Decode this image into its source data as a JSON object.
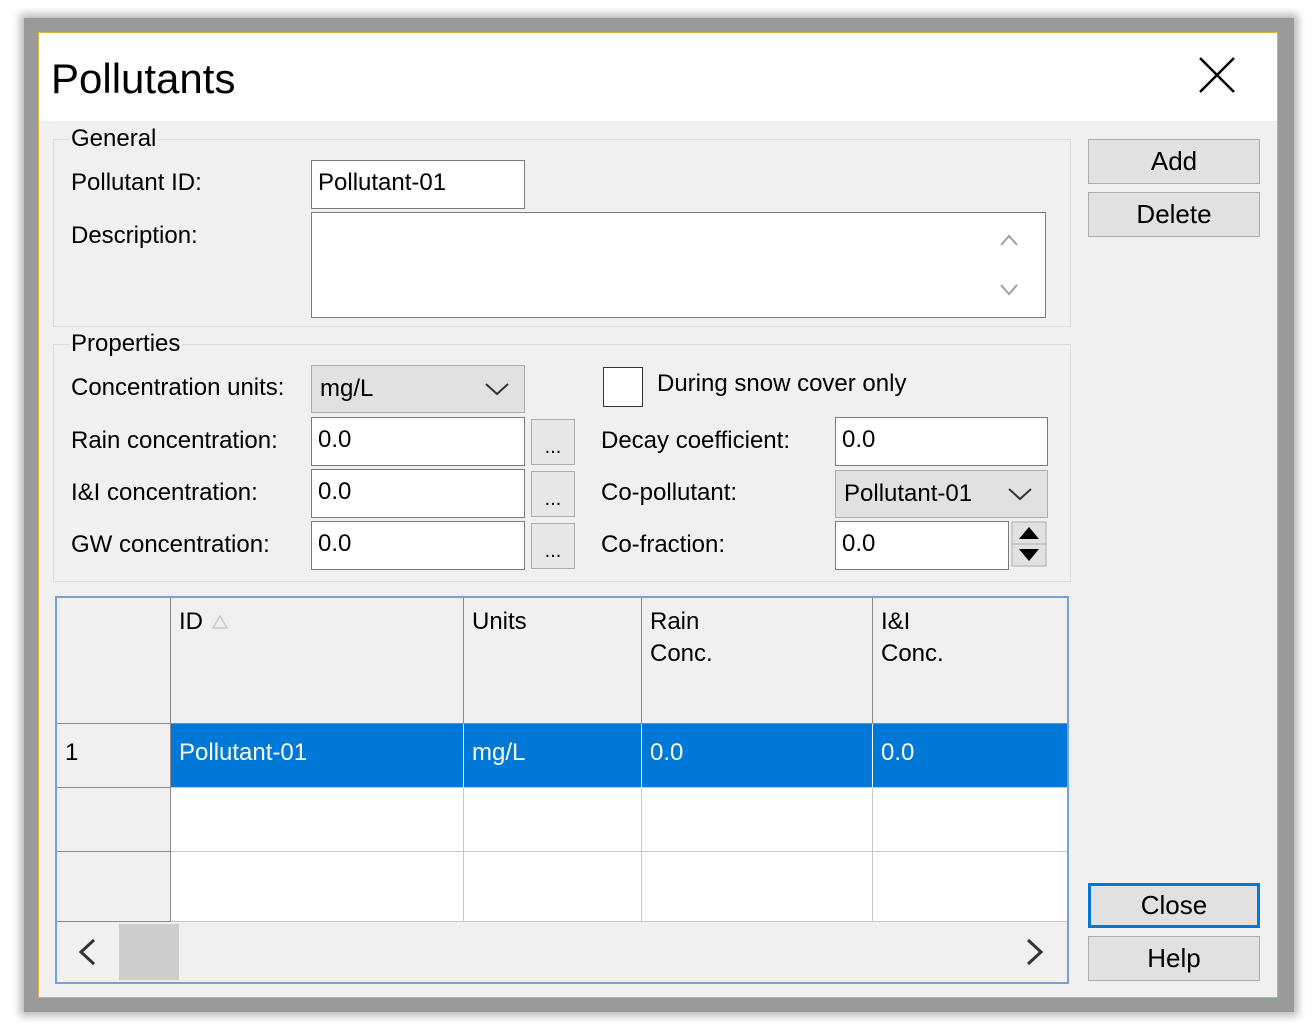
{
  "window": {
    "title": "Pollutants"
  },
  "general": {
    "title": "General",
    "pollutant_id_label": "Pollutant ID:",
    "pollutant_id_value": "Pollutant-01",
    "description_label": "Description:",
    "description_value": ""
  },
  "properties": {
    "title": "Properties",
    "conc_units_label": "Concentration units:",
    "conc_units_value": "mg/L",
    "rain_conc_label": "Rain concentration:",
    "rain_conc_value": "0.0",
    "ii_conc_label": "I&I concentration:",
    "ii_conc_value": "0.0",
    "gw_conc_label": "GW concentration:",
    "gw_conc_value": "0.0",
    "ellipsis": "...",
    "snow_only_label": "During snow cover only",
    "snow_only_checked": false,
    "decay_label": "Decay coefficient:",
    "decay_value": "0.0",
    "co_pollutant_label": "Co-pollutant:",
    "co_pollutant_value": "Pollutant-01",
    "co_fraction_label": "Co-fraction:",
    "co_fraction_value": "0.0"
  },
  "buttons": {
    "add": "Add",
    "delete": "Delete",
    "close": "Close",
    "help": "Help"
  },
  "table": {
    "headers": [
      {
        "line1": "ID",
        "line2": ""
      },
      {
        "line1": "Units",
        "line2": ""
      },
      {
        "line1": "Rain",
        "line2": "Conc."
      },
      {
        "line1": "I&I",
        "line2": "Conc."
      }
    ],
    "rows": [
      {
        "index": "1",
        "id": "Pollutant-01",
        "units": "mg/L",
        "rain": "0.0",
        "ii": "0.0"
      }
    ]
  },
  "colors": {
    "selection": "#0078d7",
    "accent_border": "#d6b340"
  },
  "icons": {
    "close": "close-x-icon",
    "dropdown": "chevron-down-icon",
    "spinner": "spin-up-down-icon",
    "sort": "sort-up-icon"
  }
}
